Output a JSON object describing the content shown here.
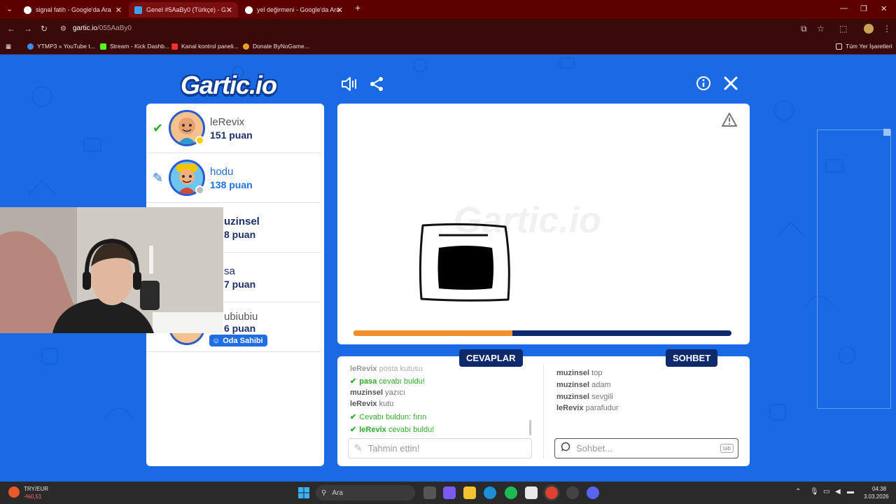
{
  "browser": {
    "tabs": [
      {
        "title": "signal fatih - Google'da Ara",
        "active": false
      },
      {
        "title": "Genel #5AaBy0 (Türkçe) - G",
        "active": true
      },
      {
        "title": "yel değirmeni - Google'da Ara",
        "active": false
      }
    ],
    "url_host": "gartic.io",
    "url_path": "/055AaBy0",
    "bookmarks": [
      {
        "label": "YTMP3 » YouTube t...",
        "color": "#3a8df0"
      },
      {
        "label": "Stream - Kick Dashb...",
        "color": "#53fc18"
      },
      {
        "label": "Kanal kontrol paneli...",
        "color": "#ff2d2d"
      },
      {
        "label": "Donate ByNoGame...",
        "color": "#f0a020"
      }
    ],
    "all_bookmarks": "Tüm Yer İşaretleri"
  },
  "game": {
    "logo": "Gartic.io",
    "players": [
      {
        "name": "leRevix",
        "points": "151 puan",
        "status": "guessed"
      },
      {
        "name": "hodu",
        "points": "138 puan",
        "status": "drawing"
      },
      {
        "name": "uzinsel",
        "points": "8 puan",
        "status": ""
      },
      {
        "name": "sa",
        "points": "7 puan",
        "status": ""
      },
      {
        "name": "ubiubiu",
        "points": "6 puan",
        "status": "",
        "badge": "Oda Sahibi"
      }
    ],
    "watermark": "Gartic.io",
    "timer_progress": 0.42,
    "answers_title": "CEVAPLAR",
    "chat_title": "SOHBET",
    "answers": [
      {
        "user": "leRevix",
        "text": "posta kutusu",
        "ok": false
      },
      {
        "user": "pasa",
        "text": "cevabı buldu!",
        "ok": true
      },
      {
        "user": "muzinsel",
        "text": "yazıcı",
        "ok": false
      },
      {
        "user": "leRevix",
        "text": "kutu",
        "ok": false
      },
      {
        "user": "",
        "text": "Cevabı buldun: fırın",
        "ok": true
      },
      {
        "user": "leRevix",
        "text": "cevabı buldu!",
        "ok": true
      }
    ],
    "chat": [
      {
        "user": "muzinsel",
        "text": "top"
      },
      {
        "user": "muzinsel",
        "text": "adam"
      },
      {
        "user": "muzinsel",
        "text": "sevgili"
      },
      {
        "user": "leRevix",
        "text": "parafudur"
      }
    ],
    "guess_placeholder": "Tahmin ettin!",
    "chat_placeholder": "Sohbet...",
    "tab_key": "tab"
  },
  "taskbar": {
    "ticker_label": "TRY/EUR",
    "ticker_value": "-%0,51",
    "search": "Ara",
    "time": "04:38",
    "date": "3.03.2026"
  }
}
